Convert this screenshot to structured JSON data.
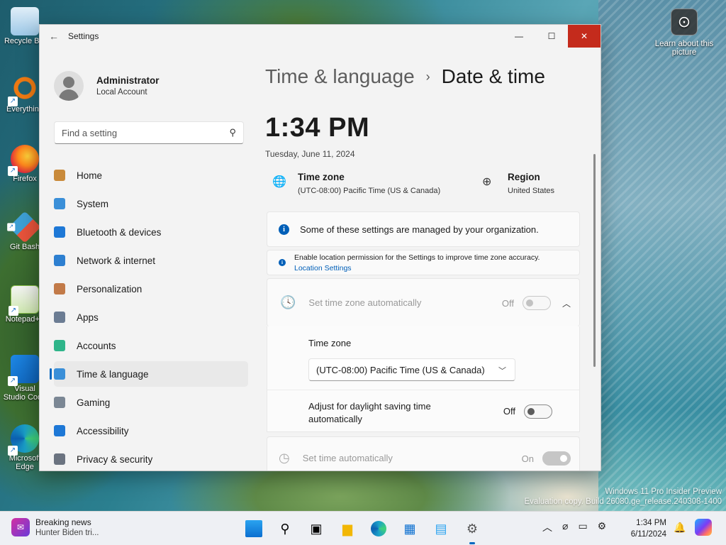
{
  "desktop": {
    "icons": [
      {
        "label": "Recycle Bin",
        "icon": "recycle-bin-icon",
        "color": "#9ec9e8"
      },
      {
        "label": "Everything",
        "icon": "everything-search-icon",
        "color": "#f07a12"
      },
      {
        "label": "Firefox",
        "icon": "firefox-icon",
        "color": "#e86020"
      },
      {
        "label": "Git Bash",
        "icon": "git-bash-icon",
        "color": "#3ea0d6"
      },
      {
        "label": "Notepad++",
        "icon": "notepad-plus-plus-icon",
        "color": "#8bc34a"
      },
      {
        "label": "Visual Studio Code",
        "icon": "vscode-icon",
        "color": "#1e88e5"
      },
      {
        "label": "Microsoft Edge",
        "icon": "edge-icon",
        "color": "#1aa0c9"
      }
    ],
    "learn_label": "Learn about this picture",
    "watermark_line1": "Windows 11 Pro Insider Preview",
    "watermark_line2": "Evaluation copy. Build 26080.ge_release.240308-1400"
  },
  "window": {
    "app_title": "Settings",
    "minimize": "—",
    "maximize": "☐",
    "close": "✕"
  },
  "sidebar": {
    "user_name": "Administrator",
    "user_account": "Local Account",
    "search_placeholder": "Find a setting",
    "items": [
      {
        "label": "Home",
        "icon": "home-icon",
        "color": "#c98a3a"
      },
      {
        "label": "System",
        "icon": "system-icon",
        "color": "#3a8fd8"
      },
      {
        "label": "Bluetooth & devices",
        "icon": "bluetooth-icon",
        "color": "#1e78d6"
      },
      {
        "label": "Network & internet",
        "icon": "network-icon",
        "color": "#2d7fd0"
      },
      {
        "label": "Personalization",
        "icon": "personalization-icon",
        "color": "#c27a48"
      },
      {
        "label": "Apps",
        "icon": "apps-icon",
        "color": "#6b7c93"
      },
      {
        "label": "Accounts",
        "icon": "accounts-icon",
        "color": "#2fb58a"
      },
      {
        "label": "Time & language",
        "icon": "time-language-icon",
        "color": "#3a8fd8"
      },
      {
        "label": "Gaming",
        "icon": "gaming-icon",
        "color": "#7b8794"
      },
      {
        "label": "Accessibility",
        "icon": "accessibility-icon",
        "color": "#1e78d6"
      },
      {
        "label": "Privacy & security",
        "icon": "privacy-shield-icon",
        "color": "#6b7380"
      }
    ],
    "active_index": 7
  },
  "content": {
    "breadcrumb_parent": "Time & language",
    "breadcrumb_sep": "›",
    "breadcrumb_current": "Date & time",
    "time": "1:34 PM",
    "date": "Tuesday, June 11, 2024",
    "timezone_label": "Time zone",
    "timezone_value": "(UTC-08:00) Pacific Time (US & Canada)",
    "region_label": "Region",
    "region_value": "United States",
    "managed_notice": "Some of these settings are managed by your organization.",
    "location_notice": "Enable location permission for the Settings to improve time zone accuracy.",
    "location_link": "Location Settings",
    "set_tz_auto_label": "Set time zone automatically",
    "set_tz_auto_state": "Off",
    "tz_field_label": "Time zone",
    "tz_select_value": "(UTC-08:00) Pacific Time (US & Canada)",
    "dst_label_line1": "Adjust for daylight saving time",
    "dst_label_line2": "automatically",
    "dst_state": "Off",
    "set_time_auto_label": "Set time automatically",
    "set_time_auto_state": "On"
  },
  "taskbar": {
    "news_title": "Breaking news",
    "news_subtitle": "Hunter Biden tri...",
    "clock_time": "1:34 PM",
    "clock_date": "6/11/2024",
    "apps": [
      "windows-start-icon",
      "search-icon",
      "task-view-icon",
      "file-explorer-icon",
      "edge-icon",
      "store-icon",
      "photos-icon",
      "settings-icon"
    ]
  }
}
